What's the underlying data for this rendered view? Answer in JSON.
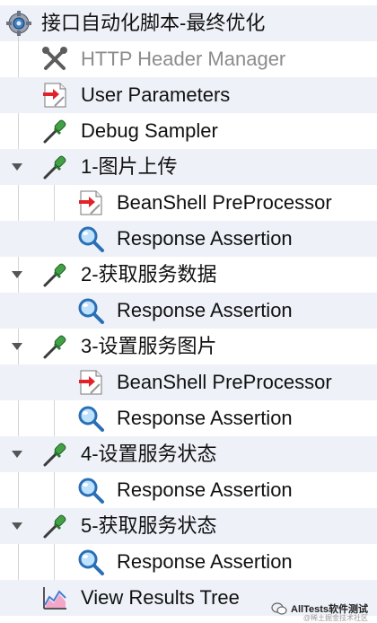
{
  "tree": {
    "root": {
      "label": "接口自动化脚本-最终优化",
      "icon": "gear-icon"
    },
    "items": [
      {
        "label": "HTTP Header Manager",
        "icon": "wrench-tools-icon",
        "disabled": true
      },
      {
        "label": "User Parameters",
        "icon": "preprocessor-icon"
      },
      {
        "label": "Debug Sampler",
        "icon": "pipette-icon"
      },
      {
        "label": "1-图片上传",
        "icon": "pipette-icon",
        "expanded": true
      },
      {
        "label": "BeanShell PreProcessor",
        "icon": "preprocessor-icon"
      },
      {
        "label": "Response Assertion",
        "icon": "magnifier-icon"
      },
      {
        "label": "2-获取服务数据",
        "icon": "pipette-icon",
        "expanded": true
      },
      {
        "label": "Response Assertion",
        "icon": "magnifier-icon"
      },
      {
        "label": "3-设置服务图片",
        "icon": "pipette-icon",
        "expanded": true
      },
      {
        "label": "BeanShell PreProcessor",
        "icon": "preprocessor-icon"
      },
      {
        "label": "Response Assertion",
        "icon": "magnifier-icon"
      },
      {
        "label": "4-设置服务状态",
        "icon": "pipette-icon",
        "expanded": true
      },
      {
        "label": "Response Assertion",
        "icon": "magnifier-icon"
      },
      {
        "label": "5-获取服务状态",
        "icon": "pipette-icon",
        "expanded": true
      },
      {
        "label": "Response Assertion",
        "icon": "magnifier-icon"
      },
      {
        "label": "View Results Tree",
        "icon": "results-tree-icon"
      }
    ]
  },
  "watermark": {
    "main": "AllTests软件测试",
    "sub": "@稀土掘金技术社区"
  }
}
